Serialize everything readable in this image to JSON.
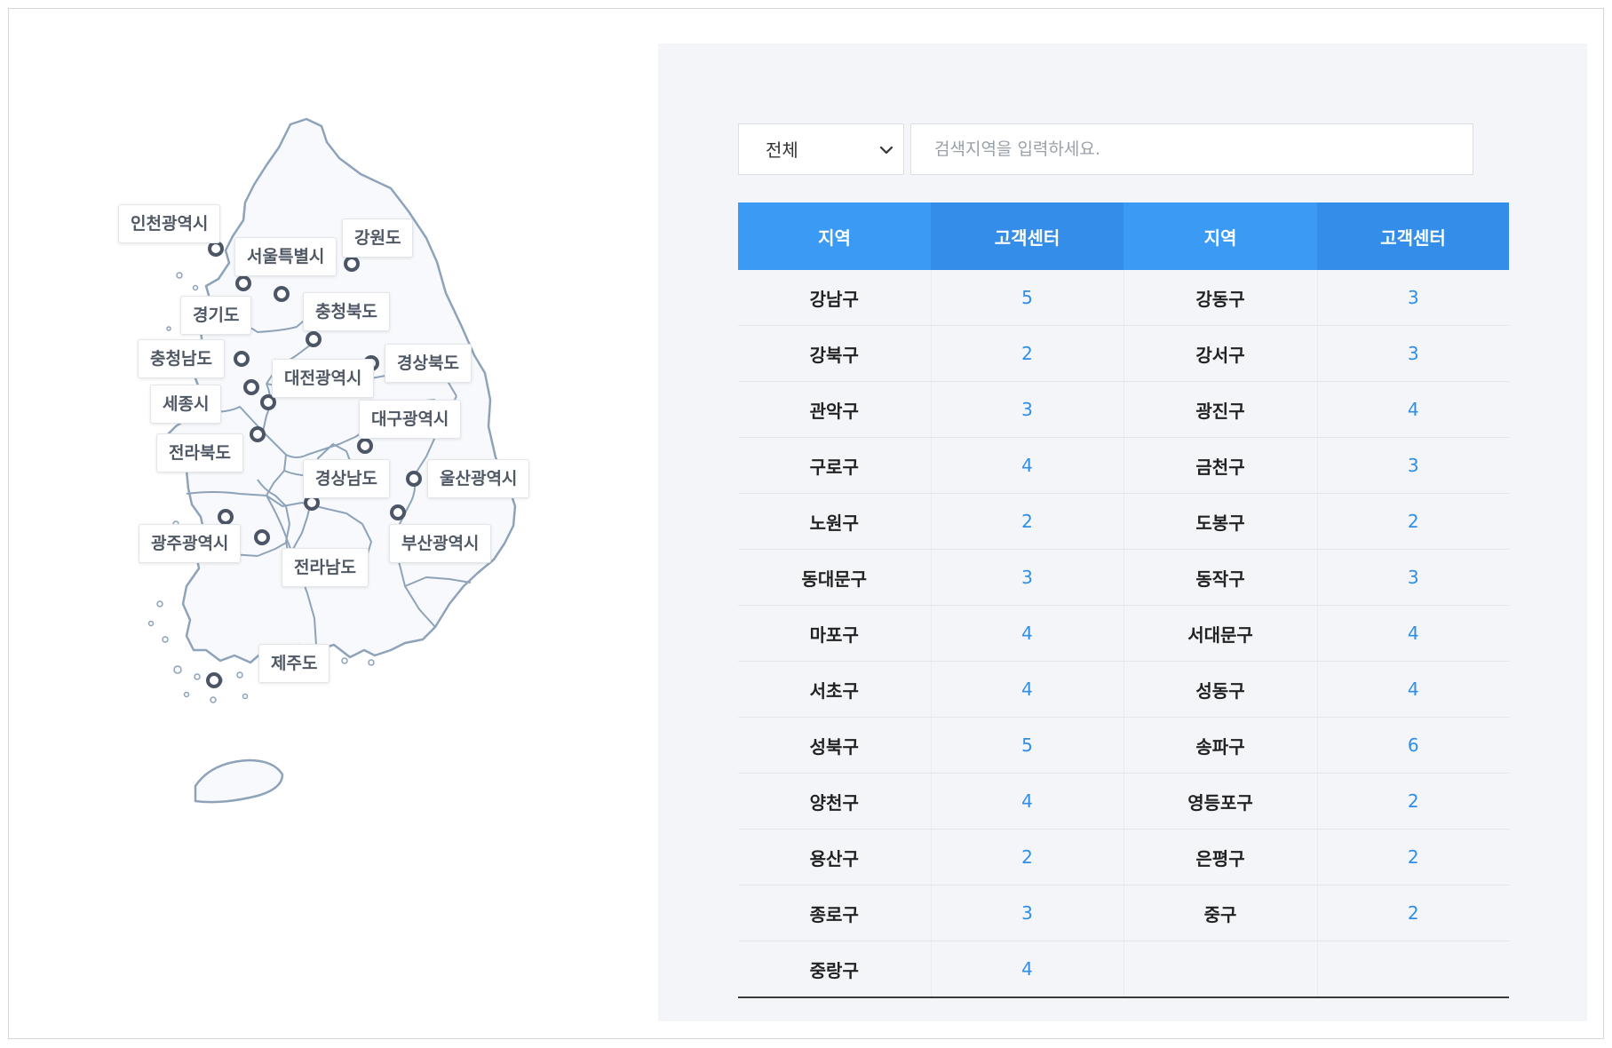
{
  "map": {
    "regions": [
      {
        "id": "incheon",
        "label": "인천광역시"
      },
      {
        "id": "seoul",
        "label": "서울특별시"
      },
      {
        "id": "gangwon",
        "label": "강원도"
      },
      {
        "id": "gyeonggi",
        "label": "경기도"
      },
      {
        "id": "chungbuk",
        "label": "충청북도"
      },
      {
        "id": "chungnam",
        "label": "충청남도"
      },
      {
        "id": "daejeon",
        "label": "대전광역시"
      },
      {
        "id": "gyeongbuk",
        "label": "경상북도"
      },
      {
        "id": "sejong",
        "label": "세종시"
      },
      {
        "id": "daegu",
        "label": "대구광역시"
      },
      {
        "id": "jeonbuk",
        "label": "전라북도"
      },
      {
        "id": "gyeongnam",
        "label": "경상남도"
      },
      {
        "id": "ulsan",
        "label": "울산광역시"
      },
      {
        "id": "gwangju",
        "label": "광주광역시"
      },
      {
        "id": "busan",
        "label": "부산광역시"
      },
      {
        "id": "jeonnam",
        "label": "전라남도"
      },
      {
        "id": "jeju",
        "label": "제주도"
      }
    ]
  },
  "search": {
    "select_value": "전체",
    "input_placeholder": "검색지역을 입력하세요.",
    "input_value": ""
  },
  "table": {
    "headers": [
      "지역",
      "고객센터",
      "지역",
      "고객센터"
    ],
    "rows": [
      [
        "강남구",
        "5",
        "강동구",
        "3"
      ],
      [
        "강북구",
        "2",
        "강서구",
        "3"
      ],
      [
        "관악구",
        "3",
        "광진구",
        "4"
      ],
      [
        "구로구",
        "4",
        "금천구",
        "3"
      ],
      [
        "노원구",
        "2",
        "도봉구",
        "2"
      ],
      [
        "동대문구",
        "3",
        "동작구",
        "3"
      ],
      [
        "마포구",
        "4",
        "서대문구",
        "4"
      ],
      [
        "서초구",
        "4",
        "성동구",
        "4"
      ],
      [
        "성북구",
        "5",
        "송파구",
        "6"
      ],
      [
        "양천구",
        "4",
        "영등포구",
        "2"
      ],
      [
        "용산구",
        "2",
        "은평구",
        "2"
      ],
      [
        "종로구",
        "3",
        "중구",
        "2"
      ],
      [
        "중랑구",
        "4",
        "",
        ""
      ]
    ]
  },
  "colors": {
    "header_blue": "#3b9af3",
    "header_blue_alt": "#348de8",
    "count_blue": "#2f8fe8",
    "panel_bg": "#f3f5f8",
    "map_fill": "#f7f9fc",
    "map_stroke": "#8ea3b9",
    "pin": "#4c5566"
  }
}
